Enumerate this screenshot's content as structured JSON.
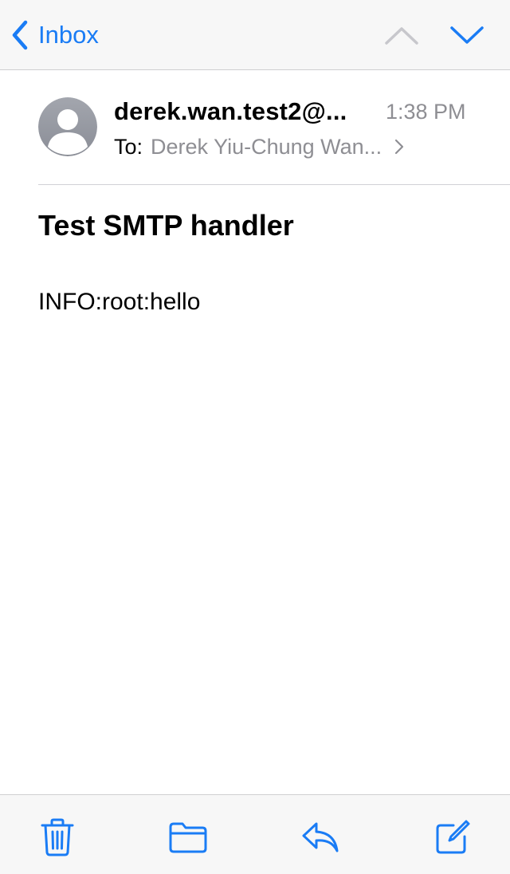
{
  "nav": {
    "back_label": "Inbox",
    "back_icon": "chevron-left-icon",
    "previous_icon": "chevron-up-icon",
    "next_icon": "chevron-down-icon"
  },
  "message": {
    "sender": "derek.wan.test2@...",
    "time": "1:38 PM",
    "to_label": "To:",
    "to_value": "Derek Yiu-Chung Wan...",
    "subject": "Test SMTP handler",
    "body": "INFO:root:hello"
  },
  "toolbar": {
    "icons": [
      "trash-icon",
      "folder-icon",
      "reply-icon",
      "compose-icon"
    ]
  },
  "colors": {
    "accent": "#1a7cf5",
    "secondary_text": "#8e8e93",
    "disabled": "#c7c7cc",
    "bar_background": "#f7f7f7"
  }
}
